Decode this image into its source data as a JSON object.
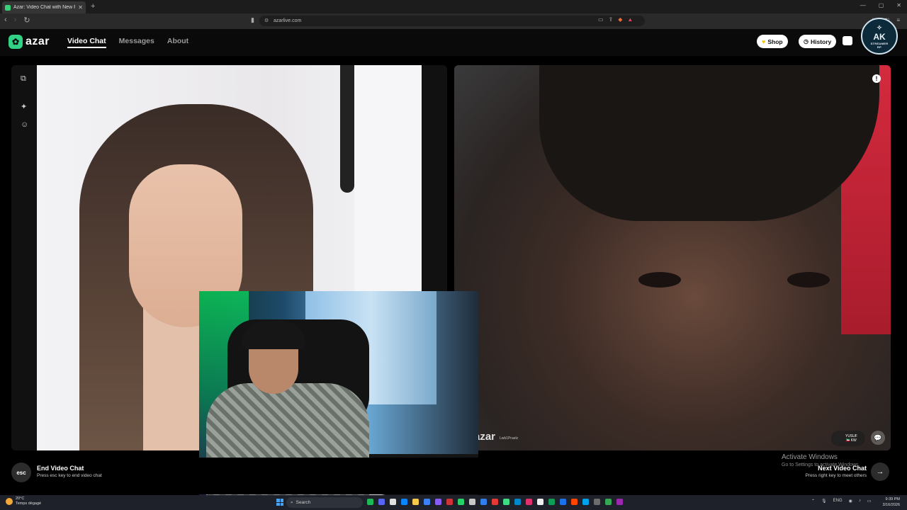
{
  "browser": {
    "tab_title": "Azar: Video Chat with New Pe",
    "tab_close": "✕",
    "new_tab": "+",
    "url": "azarlive.com",
    "window_controls": [
      "—",
      "▢",
      "✕"
    ]
  },
  "site": {
    "logo_text": "azar",
    "nav": [
      {
        "label": "Video Chat",
        "active": true
      },
      {
        "label": "Messages",
        "active": false
      },
      {
        "label": "About",
        "active": false
      }
    ],
    "shop_label": "Shop",
    "history_label": "History",
    "avatar_text": "AK",
    "avatar_sub": "STREAMER",
    "avatar_sub2": "RP"
  },
  "remote_video": {
    "watermark": "azar",
    "watermark_sub": "Lwb1Praelz",
    "user_name": "YUSUF",
    "user_sub": "🇰🇼 KW"
  },
  "bottom": {
    "esc_key": "esc",
    "end_title": "End Video Chat",
    "end_sub": "Press esc key to end video chat",
    "activate_title": "Activate Windows",
    "activate_sub": "Go to Settings to activate Windows.",
    "next_title": "Next Video Chat",
    "next_sub": "Press right key to meet others",
    "next_arrow": "→"
  },
  "taskbar": {
    "temp": "20°C",
    "weather": "Temps dégagé",
    "search_label": "Search",
    "lang": "ENG",
    "time": "9:39 PM",
    "date": "3/16/2026",
    "icon_colors": [
      "#1db954",
      "#5865f2",
      "#e0e0e0",
      "#0a84ff",
      "#f7c948",
      "#3b82f6",
      "#8a5cf6",
      "#d13438",
      "#25d366",
      "#c8c8c8",
      "#2f80ed",
      "#e53935",
      "#3ddc84",
      "#0088cc",
      "#e1306c",
      "#f0f0f0",
      "#0f9d58",
      "#1a73e8",
      "#ff4500",
      "#00a2ed",
      "#6d6d6d",
      "#34a853",
      "#9c27b0"
    ]
  },
  "colors": {
    "brand_green": "#31d285",
    "active_nav": "#ffffff",
    "inactive_nav": "#9a9a9a"
  }
}
